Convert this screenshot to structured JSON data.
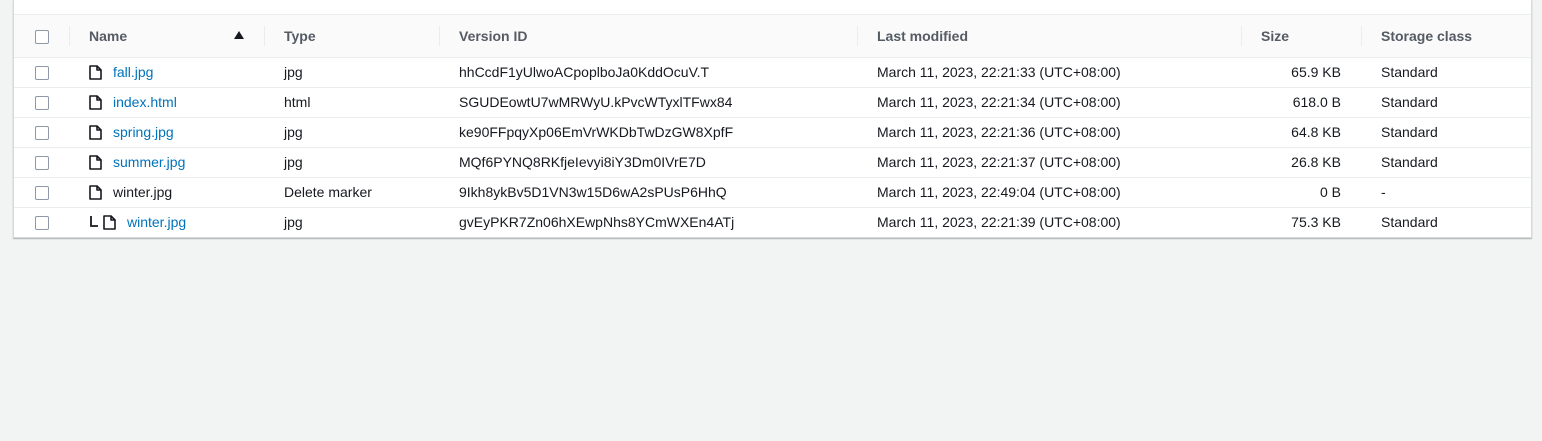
{
  "table": {
    "headers": {
      "name": "Name",
      "type": "Type",
      "version_id": "Version ID",
      "last_modified": "Last modified",
      "size": "Size",
      "storage_class": "Storage class"
    },
    "sort": {
      "column": "name",
      "direction": "ascending",
      "icon": "caret-up-icon"
    },
    "rows": [
      {
        "name": "fall.jpg",
        "type": "jpg",
        "version_id": "hhCcdF1yUlwoACpoplboJa0KddOcuV.T",
        "last_modified": "March 11, 2023, 22:21:33 (UTC+08:00)",
        "size": "65.9 KB",
        "storage_class": "Standard"
      },
      {
        "name": "index.html",
        "type": "html",
        "version_id": "SGUDEowtU7wMRWyU.kPvcWTyxlTFwx84",
        "last_modified": "March 11, 2023, 22:21:34 (UTC+08:00)",
        "size": "618.0 B",
        "storage_class": "Standard"
      },
      {
        "name": "spring.jpg",
        "type": "jpg",
        "version_id": "ke90FFpqyXp06EmVrWKDbTwDzGW8XpfF",
        "last_modified": "March 11, 2023, 22:21:36 (UTC+08:00)",
        "size": "64.8 KB",
        "storage_class": "Standard"
      },
      {
        "name": "summer.jpg",
        "type": "jpg",
        "version_id": "MQf6PYNQ8RKfjeIevyi8iY3Dm0IVrE7D",
        "last_modified": "March 11, 2023, 22:21:37 (UTC+08:00)",
        "size": "26.8 KB",
        "storage_class": "Standard"
      },
      {
        "name": "winter.jpg",
        "type": "Delete marker",
        "version_id": "9Ikh8ykBv5D1VN3w15D6wA2sPUsP6HhQ",
        "last_modified": "March 11, 2023, 22:49:04 (UTC+08:00)",
        "size": "0 B",
        "storage_class": "-"
      },
      {
        "name": "winter.jpg",
        "type": "jpg",
        "version_id": "gvEyPKR7Zn06hXEwpNhs8YCmWXEn4ATj",
        "last_modified": "March 11, 2023, 22:21:39 (UTC+08:00)",
        "size": "75.3 KB",
        "storage_class": "Standard"
      }
    ]
  },
  "colors": {
    "link": "#0073bb",
    "header_text": "#545b64",
    "page_background": "#f2f3f3"
  }
}
